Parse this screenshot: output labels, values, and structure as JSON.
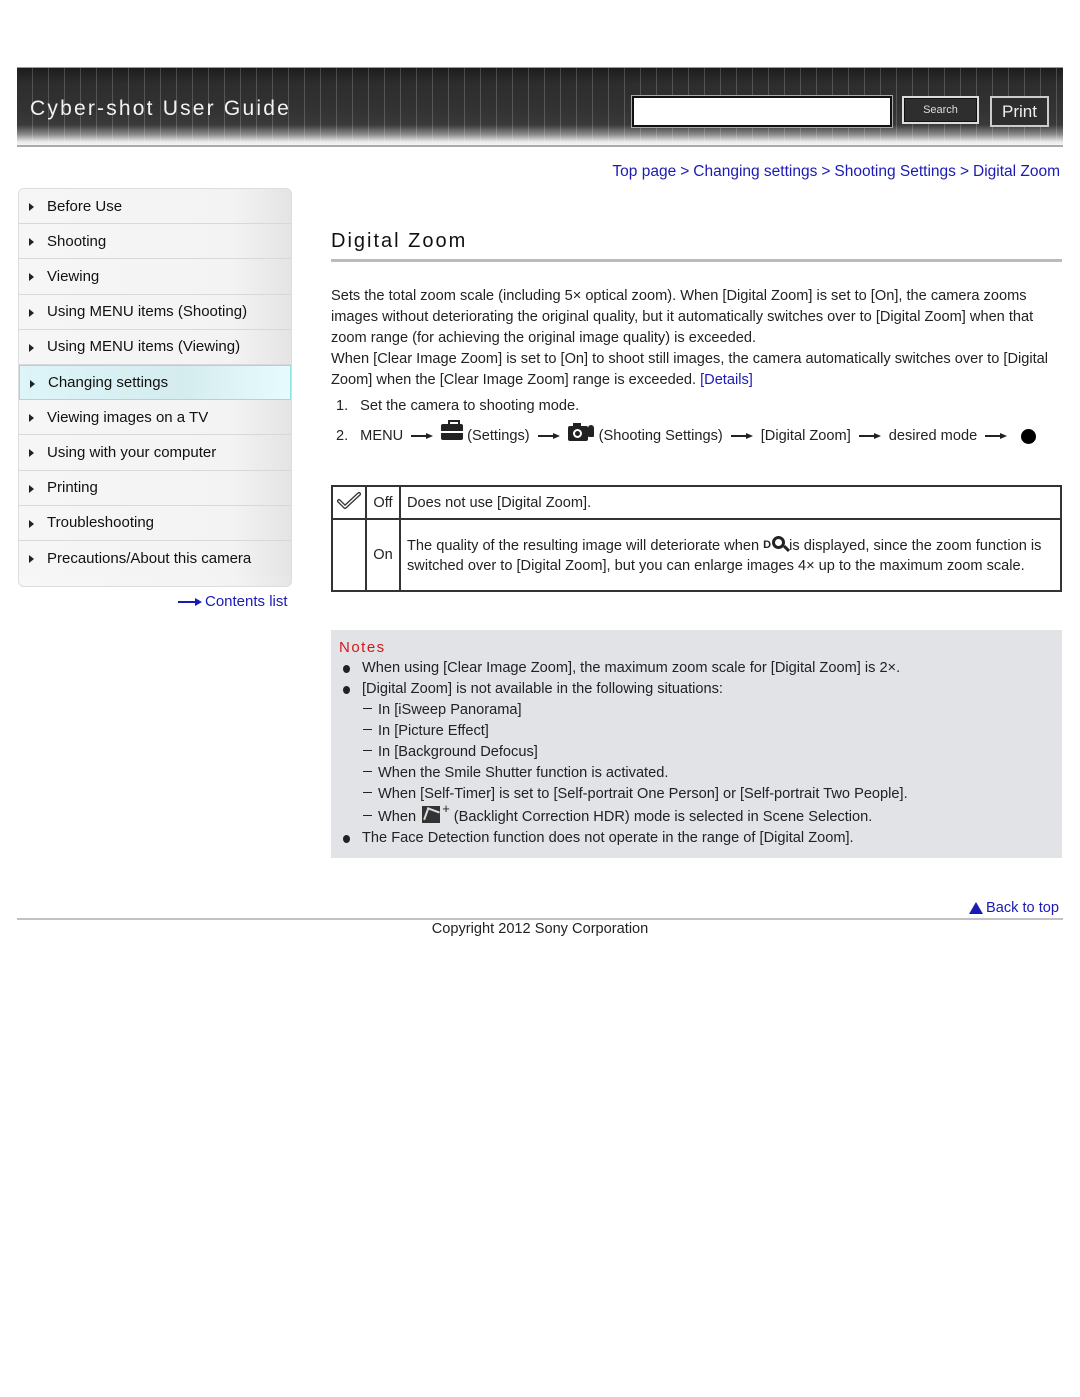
{
  "header": {
    "app_title": "Cyber-shot User Guide",
    "search_placeholder": "",
    "search_value": "",
    "search_label": "Search",
    "print_label": "Print"
  },
  "sidebar": {
    "items": [
      {
        "label": "Before Use",
        "active": false
      },
      {
        "label": "Shooting",
        "active": false
      },
      {
        "label": "Viewing",
        "active": false
      },
      {
        "label": "Using MENU items (Shooting)",
        "active": false
      },
      {
        "label": "Using MENU items (Viewing)",
        "active": false
      },
      {
        "label": "Changing settings",
        "active": true
      },
      {
        "label": "Viewing images on a TV",
        "active": false
      },
      {
        "label": "Using with your computer",
        "active": false
      },
      {
        "label": "Printing",
        "active": false
      },
      {
        "label": "Troubleshooting",
        "active": false
      },
      {
        "label": "Precautions/About this camera",
        "active": false
      }
    ],
    "contents_link": "Contents list"
  },
  "breadcrumb": {
    "items": [
      "Top page",
      "Changing settings",
      "Shooting Settings",
      "Digital Zoom"
    ],
    "separator": ">"
  },
  "main": {
    "title": "Digital Zoom",
    "intro_line1": "Sets the total zoom scale (including 5× optical zoom). When [Digital Zoom] is set to [On], the camera zooms images without deteriorating the original quality, but it automatically switches over to [Digital Zoom] when that zoom range (for achieving the original image quality) is exceeded.",
    "intro_line2": "When [Clear Image Zoom] is set to [On] to shoot still images, the camera automatically switches over to [Digital Zoom] when the [Clear Image Zoom] range is exceeded.",
    "details_link": "[Details]",
    "steps": {
      "step1_num": "1.",
      "step1_text": "Set the camera to shooting mode.",
      "step2_num": "2.",
      "step2_menu": "MENU",
      "step2_settings": "(Settings)",
      "step2_shooting_settings": "(Shooting Settings)",
      "step2_digital_zoom": "[Digital Zoom]",
      "step2_desired_mode": "desired mode"
    },
    "options": [
      {
        "default": true,
        "name": "Off",
        "description": "Does not use [Digital Zoom]."
      },
      {
        "default": false,
        "name": "On",
        "description_before_icon": "The quality of the resulting image will deteriorate when",
        "description_after_icon": "is displayed, since the zoom function is switched over to [Digital Zoom], but you can enlarge images 4× up to the maximum zoom scale."
      }
    ]
  },
  "notes": {
    "title": "Notes",
    "bullet1": "When using [Clear Image Zoom], the maximum zoom scale for [Digital Zoom] is 2×.",
    "bullet2": "[Digital Zoom] is not available in the following situations:",
    "sub1": "In [iSweep Panorama]",
    "sub2": "In [Picture Effect]",
    "sub3": "In [Background Defocus]",
    "sub4": "When the Smile Shutter function is activated.",
    "sub5": "When [Self-Timer] is set to [Self-portrait One Person] or [Self-portrait Two People].",
    "sub6_before": "When",
    "sub6_after": "(Backlight Correction HDR) mode is selected in Scene Selection.",
    "hdr_plus": "+",
    "bullet3": "The Face Detection function does not operate in the range of [Digital Zoom]."
  },
  "footer": {
    "back_to_top": "Back to top",
    "copyright": "Copyright 2012 Sony Corporation"
  },
  "colors": {
    "link": "#1a1ab5",
    "notes_title": "#d21a1a",
    "notes_bg": "#e1e3e7",
    "active_nav": "#d5ecef"
  }
}
